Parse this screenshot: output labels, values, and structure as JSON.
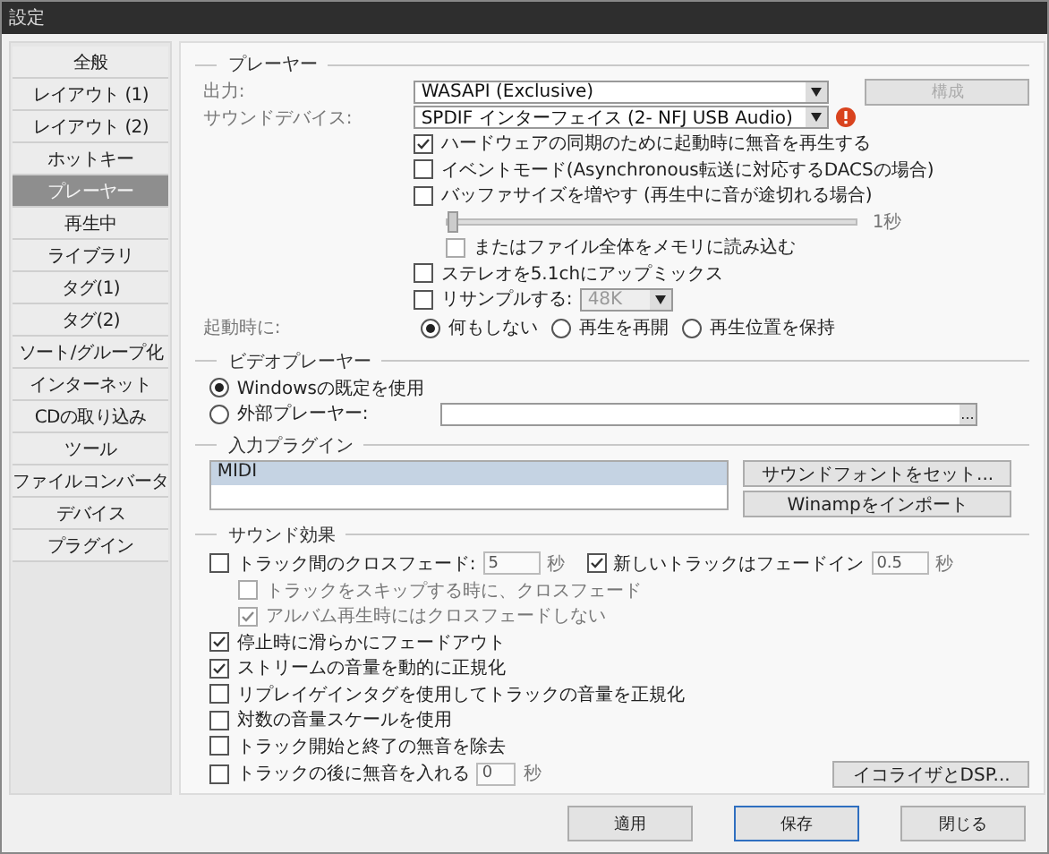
{
  "window": {
    "title": "設定"
  },
  "sidebar": {
    "items": [
      {
        "label": "全般",
        "selected": false
      },
      {
        "label": "レイアウト (1)",
        "selected": false
      },
      {
        "label": "レイアウト (2)",
        "selected": false
      },
      {
        "label": "ホットキー",
        "selected": false
      },
      {
        "label": "プレーヤー",
        "selected": true
      },
      {
        "label": "再生中",
        "selected": false
      },
      {
        "label": "ライブラリ",
        "selected": false
      },
      {
        "label": "タグ(1)",
        "selected": false
      },
      {
        "label": "タグ(2)",
        "selected": false
      },
      {
        "label": "ソート/グループ化",
        "selected": false
      },
      {
        "label": "インターネット",
        "selected": false
      },
      {
        "label": "CDの取り込み",
        "selected": false
      },
      {
        "label": "ツール",
        "selected": false
      },
      {
        "label": "ファイルコンバータ",
        "selected": false
      },
      {
        "label": "デバイス",
        "selected": false
      },
      {
        "label": "プラグイン",
        "selected": false
      }
    ]
  },
  "player": {
    "title": "プレーヤー",
    "output": {
      "label": "出力:",
      "value": "WASAPI (Exclusive)"
    },
    "config_button": {
      "label": "構成",
      "disabled": true
    },
    "device": {
      "label": "サウンドデバイス:",
      "value": "SPDIF インターフェイス (2- NFJ USB Audio)",
      "warning": true
    },
    "options": [
      {
        "kind": "check",
        "label": "ハードウェアの同期のために起動時に無音を再生する",
        "checked": true
      },
      {
        "kind": "check",
        "label": "イベントモード(Asynchronous転送に対応するDACSの場合)",
        "checked": false
      },
      {
        "kind": "check",
        "label": "バッファサイズを増やす (再生中に音が途切れる場合)",
        "checked": false
      },
      {
        "kind": "slider",
        "level": 0.0,
        "reading": "1秒"
      },
      {
        "kind": "subcheck",
        "label": "またはファイル全体をメモリに読み込む",
        "checked": false
      },
      {
        "kind": "check",
        "label": "ステレオを5.1chにアップミックス",
        "checked": false
      },
      {
        "kind": "resample",
        "label": "リサンプルする:",
        "checked": false,
        "value": "48K"
      }
    ],
    "startup": {
      "label": "起動時に:",
      "options": [
        {
          "label": "何もしない",
          "selected": true
        },
        {
          "label": "再生を再開",
          "selected": false
        },
        {
          "label": "再生位置を保持",
          "selected": false
        }
      ]
    }
  },
  "video": {
    "title": "ビデオプレーヤー",
    "options": [
      {
        "label": "Windowsの既定を使用",
        "selected": true
      },
      {
        "label": "外部プレーヤー:",
        "selected": false
      }
    ],
    "browse_button": "..."
  },
  "input_plugins": {
    "title": "入力プラグイン",
    "items": [
      {
        "label": "MIDI",
        "selected": true
      }
    ],
    "buttons": [
      "サウンドフォントをセット...",
      "Winampをインポート"
    ]
  },
  "sound_effects": {
    "title": "サウンド効果",
    "crossfade": {
      "label": "トラック間のクロスフェード:",
      "checked": false,
      "value": "5",
      "unit": "秒"
    },
    "fade_in": {
      "label": "新しいトラックはフェードイン",
      "checked": true,
      "value": "0.5",
      "unit": "秒"
    },
    "sub_options": [
      {
        "label": "トラックをスキップする時に、クロスフェード",
        "checked": false
      },
      {
        "label": "アルバム再生時にはクロスフェードしない",
        "checked": true
      }
    ],
    "options": [
      {
        "label": "停止時に滑らかにフェードアウト",
        "checked": true
      },
      {
        "label": "ストリームの音量を動的に正規化",
        "checked": true
      },
      {
        "label": "リプレイゲインタグを使用してトラックの音量を正規化",
        "checked": false
      },
      {
        "label": "対数の音量スケールを使用",
        "checked": false
      },
      {
        "label": "トラック開始と終了の無音を除去",
        "checked": false
      }
    ],
    "silence": {
      "label": "トラックの後に無音を入れる",
      "checked": false,
      "value": "0",
      "unit": "秒"
    },
    "dsp_button": "イコライザとDSP..."
  },
  "footer": {
    "buttons": [
      {
        "label": "適用",
        "default": false
      },
      {
        "label": "保存",
        "default": true
      },
      {
        "label": "閉じる",
        "default": false
      }
    ]
  }
}
